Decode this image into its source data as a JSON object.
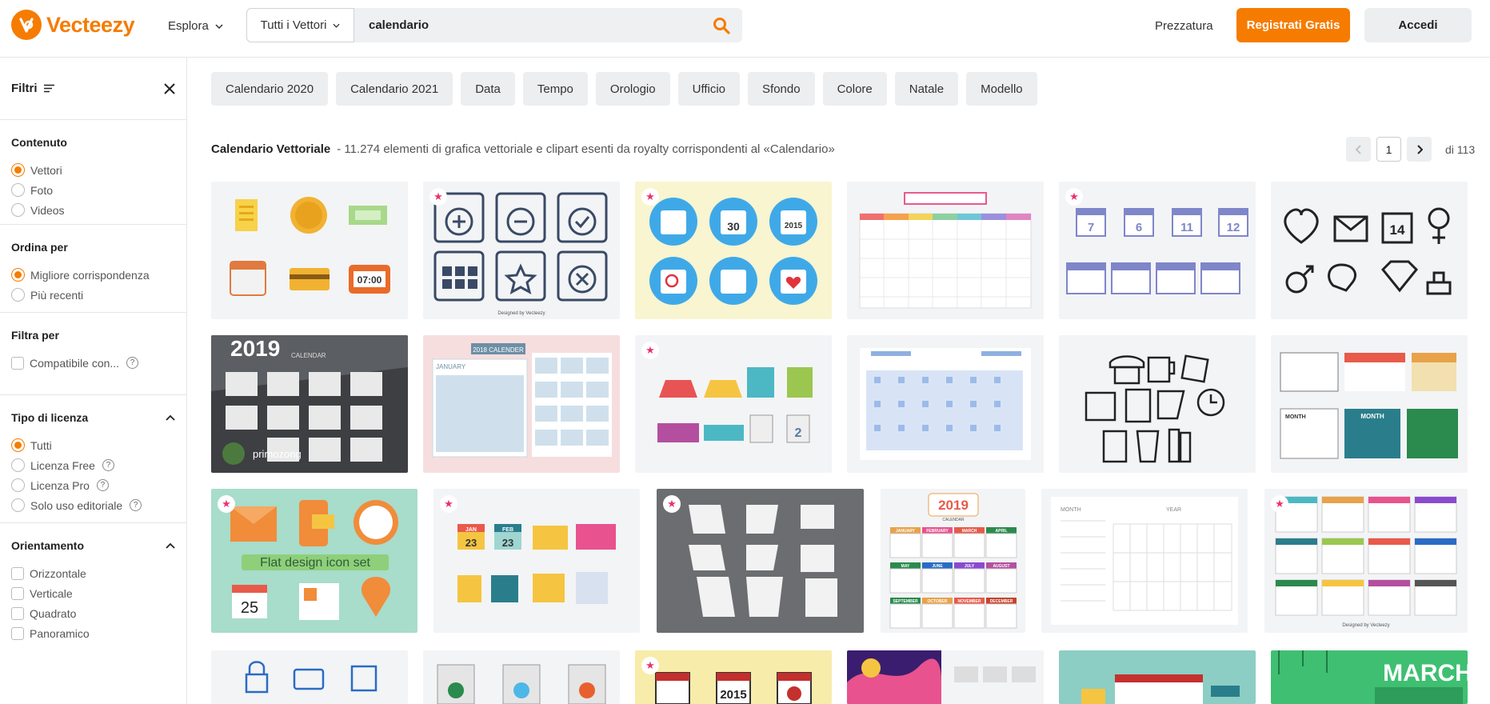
{
  "brand": {
    "name": "Vecteezy",
    "color": "#f57c00"
  },
  "nav": {
    "explore": "Esplora",
    "pricing": "Prezzatura",
    "register": "Registrati Gratis",
    "login": "Accedi"
  },
  "search": {
    "scope": "Tutti i Vettori",
    "query": "calendario"
  },
  "sidebar": {
    "title": "Filtri",
    "content": {
      "title": "Contenuto",
      "options": [
        "Vettori",
        "Foto",
        "Videos"
      ],
      "selected": "Vettori"
    },
    "sort": {
      "title": "Ordina per",
      "options": [
        "Migliore corrispondenza",
        "Più recenti"
      ],
      "selected": "Migliore corrispondenza"
    },
    "filter": {
      "title": "Filtra per",
      "options": [
        "Compatibile con..."
      ]
    },
    "license": {
      "title": "Tipo di licenza",
      "options": [
        "Tutti",
        "Licenza Free",
        "Licenza Pro",
        "Solo uso editoriale"
      ],
      "selected": "Tutti"
    },
    "orientation": {
      "title": "Orientamento",
      "options": [
        "Orizzontale",
        "Verticale",
        "Quadrato",
        "Panoramico"
      ]
    }
  },
  "tags": [
    "Calendario 2020",
    "Calendario 2021",
    "Data",
    "Tempo",
    "Orologio",
    "Ufficio",
    "Sfondo",
    "Colore",
    "Natale",
    "Modello"
  ],
  "results": {
    "title": "Calendario Vettoriale",
    "description": "- 11.274 elementi di grafica vettoriale e clipart esenti da royalty corrispondenti al «Calendario»",
    "page": "1",
    "total": "di 113"
  },
  "tiles": [
    {
      "name": "tile-finance-icons",
      "bg": "#f3f4f6",
      "pro": false
    },
    {
      "name": "tile-calendar-action-icons",
      "bg": "#f3f4f6",
      "pro": true,
      "caption": "Designed by Vecteezy"
    },
    {
      "name": "tile-round-calendar-icons",
      "bg": "#f8f5d0",
      "pro": true,
      "texts": [
        "30",
        "2015"
      ]
    },
    {
      "name": "tile-weekly-planner",
      "bg": "#f3f4f6",
      "pro": false
    },
    {
      "name": "tile-purple-calendar-icons",
      "bg": "#f3f4f6",
      "pro": true,
      "texts": [
        "7",
        "6",
        "11",
        "12"
      ]
    },
    {
      "name": "tile-line-icons",
      "bg": "#f3f4f6",
      "pro": false,
      "texts": [
        "14"
      ]
    },
    {
      "name": "tile-2019-calendar-dark",
      "bg": "#3d3f42",
      "pro": false,
      "texts": [
        "2019",
        "CALENDAR",
        "primozong"
      ]
    },
    {
      "name": "tile-2018-calendar-pink",
      "bg": "#f6dede",
      "pro": false,
      "texts": [
        "2018 CALENDER",
        "JANUARY"
      ]
    },
    {
      "name": "tile-desk-calendars",
      "bg": "#f3f4f6",
      "pro": true,
      "texts": [
        "2"
      ]
    },
    {
      "name": "tile-blue-planner",
      "bg": "#f3f4f6",
      "pro": false
    },
    {
      "name": "tile-office-line-icons",
      "bg": "#f3f4f6",
      "pro": false
    },
    {
      "name": "tile-month-calendars",
      "bg": "#f3f4f6",
      "pro": false,
      "texts": [
        "MONTH",
        "MONTH"
      ]
    },
    {
      "name": "tile-flat-design-icon-set",
      "bg": "#a8dccb",
      "pro": true,
      "texts": [
        "Flat design icon set",
        "25"
      ]
    },
    {
      "name": "tile-colorful-date-icons",
      "bg": "#f3f4f6",
      "pro": true,
      "texts": [
        "JAN",
        "23",
        "FEB",
        "23"
      ]
    },
    {
      "name": "tile-white-desk-calendars",
      "bg": "#6c6d70",
      "pro": true
    },
    {
      "name": "tile-2019-color-calendar",
      "bg": "#f3f4f6",
      "pro": false,
      "texts": [
        "2019",
        "CALENDAR",
        "JANUARY",
        "FEBRUARY",
        "MARCH",
        "APRIL",
        "MAY",
        "JUNE",
        "JULY",
        "AUGUST",
        "SEPTEMBER",
        "OCTOBER",
        "NOVEMBER",
        "DECEMBER"
      ]
    },
    {
      "name": "tile-month-planner",
      "bg": "#f3f4f6",
      "pro": false,
      "texts": [
        "MONTH",
        "YEAR"
      ]
    },
    {
      "name": "tile-2017-calendar-grid",
      "bg": "#f3f4f6",
      "pro": true,
      "caption": "Designed by Vecteezy"
    },
    {
      "name": "tile-office-icons-blue",
      "bg": "#f3f4f6",
      "pro": false
    },
    {
      "name": "tile-season-calendars",
      "bg": "#f3f4f6",
      "pro": false
    },
    {
      "name": "tile-2015-calendar-yellow",
      "bg": "#f8ecaa",
      "pro": true,
      "texts": [
        "2015"
      ]
    },
    {
      "name": "tile-abstract-calendar",
      "bg": "#f3f4f6",
      "pro": false
    },
    {
      "name": "tile-teal-desk",
      "bg": "#8ccdc4",
      "pro": false
    },
    {
      "name": "tile-march-calendar",
      "bg": "#3fbf72",
      "pro": false,
      "texts": [
        "MARCH"
      ]
    }
  ]
}
